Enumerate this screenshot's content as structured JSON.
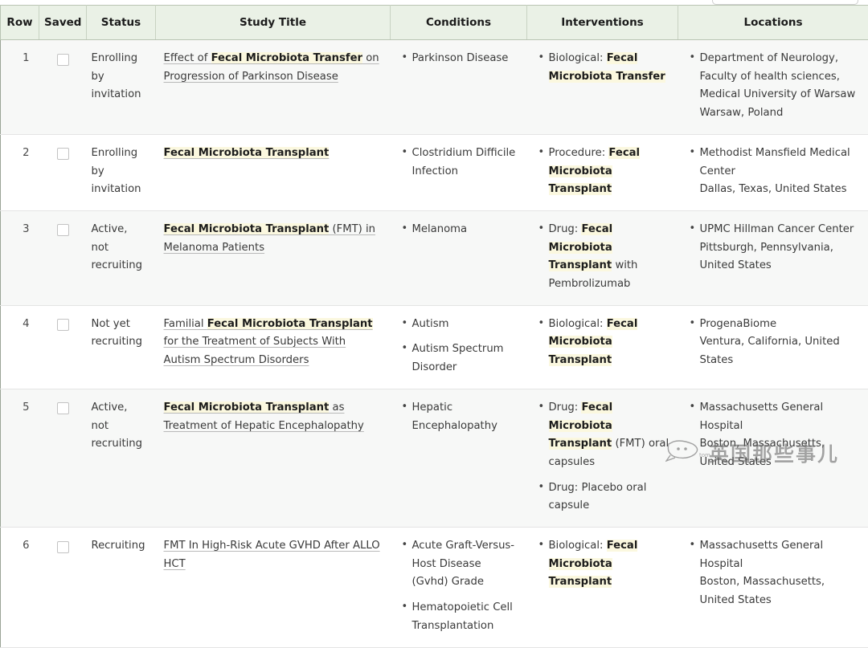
{
  "table": {
    "columns": [
      "Row",
      "Saved",
      "Status",
      "Study Title",
      "Conditions",
      "Interventions",
      "Locations"
    ],
    "colors": {
      "header_bg": "#eaf1e6",
      "status_red": "#b45c5c",
      "status_green": "#5d8052",
      "highlight": "#fbf8df",
      "odd_row_bg": "#f7f8f7",
      "even_row_bg": "#ffffff"
    },
    "rows": [
      {
        "row": "1",
        "saved": "unchecked-checkbox",
        "status": "Enrolling by invitation",
        "status_color": "red",
        "title_parts": [
          {
            "text": "Effect of ",
            "bold": false
          },
          {
            "text": "Fecal Microbiota Transfer",
            "bold": true
          },
          {
            "text": " on Progression of Parkinson Disease",
            "bold": false
          }
        ],
        "conditions": [
          [
            {
              "text": "Parkinson Disease",
              "bold": false
            }
          ]
        ],
        "interventions": [
          [
            {
              "text": "Biological: ",
              "bold": false
            },
            {
              "text": "Fecal Microbiota Transfer",
              "bold": true
            }
          ]
        ],
        "locations": [
          {
            "name": "Department of Neurology, Faculty of health sciences, Medical University of Warsaw",
            "place": "Warsaw, Poland"
          }
        ]
      },
      {
        "row": "2",
        "saved": "unchecked-checkbox",
        "status": "Enrolling by invitation",
        "status_color": "red",
        "title_parts": [
          {
            "text": "Fecal Microbiota Transplant",
            "bold": true
          }
        ],
        "conditions": [
          [
            {
              "text": "Clostridium Difficile Infection",
              "bold": false
            }
          ]
        ],
        "interventions": [
          [
            {
              "text": "Procedure: ",
              "bold": false
            },
            {
              "text": "Fecal Microbiota Transplant",
              "bold": true
            }
          ]
        ],
        "locations": [
          {
            "name": "Methodist Mansfield Medical Center",
            "place": "Dallas, Texas, United States"
          }
        ]
      },
      {
        "row": "3",
        "saved": "unchecked-checkbox",
        "status": "Active, not recruiting",
        "status_color": "red",
        "title_parts": [
          {
            "text": "Fecal Microbiota Transplant",
            "bold": true
          },
          {
            "text": " (FMT) in Melanoma Patients",
            "bold": false
          }
        ],
        "conditions": [
          [
            {
              "text": "Melanoma",
              "bold": false
            }
          ]
        ],
        "interventions": [
          [
            {
              "text": "Drug: ",
              "bold": false
            },
            {
              "text": "Fecal Microbiota Transplant",
              "bold": true
            },
            {
              "text": " with Pembrolizumab",
              "bold": false
            }
          ]
        ],
        "locations": [
          {
            "name": "UPMC Hillman Cancer Center",
            "place": "Pittsburgh, Pennsylvania, United States"
          }
        ]
      },
      {
        "row": "4",
        "saved": "unchecked-checkbox",
        "status": "Not yet recruiting",
        "status_color": "green",
        "title_parts": [
          {
            "text": "Familial ",
            "bold": false
          },
          {
            "text": "Fecal Microbiota Transplant",
            "bold": true
          },
          {
            "text": " for the Treatment of Subjects With Autism Spectrum Disorders",
            "bold": false
          }
        ],
        "conditions": [
          [
            {
              "text": "Autism",
              "bold": false
            }
          ],
          [
            {
              "text": "Autism Spectrum Disorder",
              "bold": false
            }
          ]
        ],
        "interventions": [
          [
            {
              "text": "Biological: ",
              "bold": false
            },
            {
              "text": "Fecal Microbiota Transplant",
              "bold": true
            }
          ]
        ],
        "locations": [
          {
            "name": "ProgenaBiome",
            "place": "Ventura, California, United States"
          }
        ]
      },
      {
        "row": "5",
        "saved": "unchecked-checkbox",
        "status": "Active, not recruiting",
        "status_color": "red",
        "title_parts": [
          {
            "text": "Fecal Microbiota Transplant",
            "bold": true
          },
          {
            "text": " as Treatment of Hepatic Encephalopathy",
            "bold": false
          }
        ],
        "conditions": [
          [
            {
              "text": "Hepatic Encephalopathy",
              "bold": false
            }
          ]
        ],
        "interventions": [
          [
            {
              "text": "Drug: ",
              "bold": false
            },
            {
              "text": "Fecal Microbiota Transplant",
              "bold": true
            },
            {
              "text": " (FMT) oral capsules",
              "bold": false
            }
          ],
          [
            {
              "text": "Drug: Placebo oral capsule",
              "bold": false
            }
          ]
        ],
        "locations": [
          {
            "name": "Massachusetts General Hospital",
            "place": "Boston, Massachusetts, United States"
          }
        ]
      },
      {
        "row": "6",
        "saved": "unchecked-checkbox",
        "status": "Recruiting",
        "status_color": "green",
        "title_parts": [
          {
            "text": "FMT In High-Risk Acute GVHD After ALLO HCT",
            "bold": false
          }
        ],
        "conditions": [
          [
            {
              "text": "Acute Graft-Versus-Host Disease (Gvhd) Grade",
              "bold": false
            }
          ],
          [
            {
              "text": "Hematopoietic Cell Transplantation",
              "bold": false
            }
          ]
        ],
        "interventions": [
          [
            {
              "text": "Biological: ",
              "bold": false
            },
            {
              "text": "Fecal Microbiota Transplant",
              "bold": true
            }
          ]
        ],
        "locations": [
          {
            "name": "Massachusetts General Hospital",
            "place": "Boston, Massachusetts, United States"
          }
        ]
      }
    ]
  },
  "watermark": {
    "text": "英国那些事儿",
    "sub": "tom"
  }
}
